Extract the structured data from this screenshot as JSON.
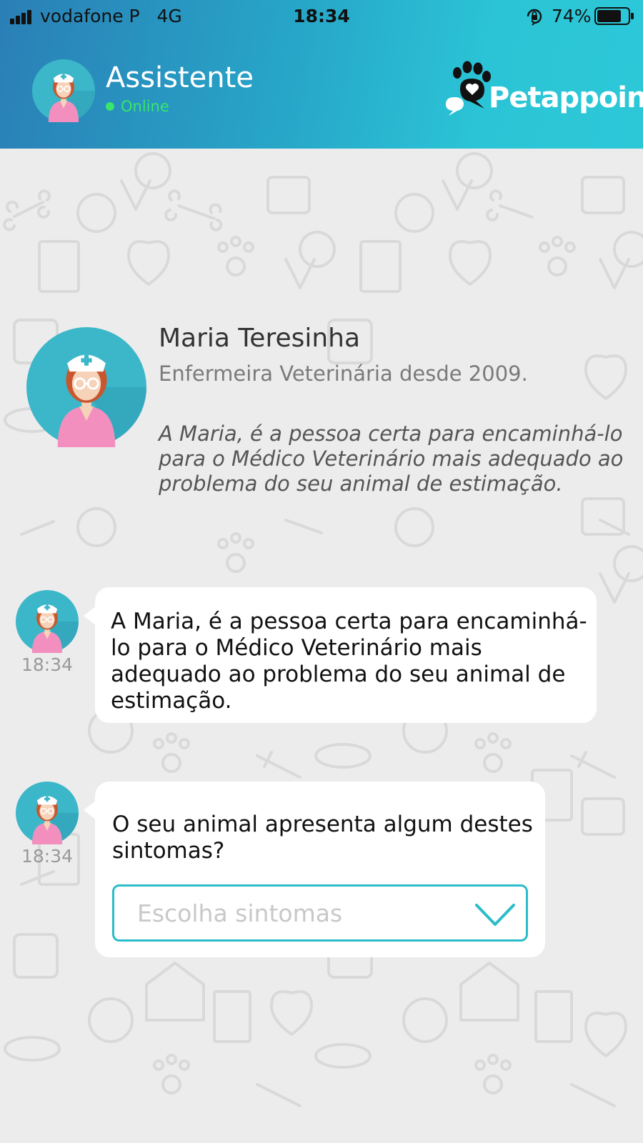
{
  "status_bar": {
    "carrier": "vodafone P",
    "network": "4G",
    "time": "18:34",
    "battery": "74%"
  },
  "header": {
    "title": "Assistente",
    "status": "Online",
    "brand": "Petappoint",
    "icons": [
      "nurse-avatar-icon",
      "paw-chat-logo-icon"
    ]
  },
  "profile": {
    "name": "Maria Teresinha",
    "role": "Enfermeira Veterinária desde 2009.",
    "description": "A Maria, é a pessoa certa para encaminhá-lo para o Médico Veterinário mais adequado ao problema do seu animal de estimação."
  },
  "messages": [
    {
      "time": "18:34",
      "text": "A Maria, é a pessoa certa para encaminhá-lo para o Médico Veterinário mais adequado ao problema do seu animal de estimação."
    },
    {
      "time": "18:34",
      "text": "O seu animal apresenta algum destes sintomas?",
      "select_placeholder": "Escolha sintomas"
    }
  ],
  "colors": {
    "header_start": "#2a7fb6",
    "header_end": "#2cc8d8",
    "online": "#37e66a",
    "accent": "#2bbcc9",
    "background": "#ececec"
  }
}
